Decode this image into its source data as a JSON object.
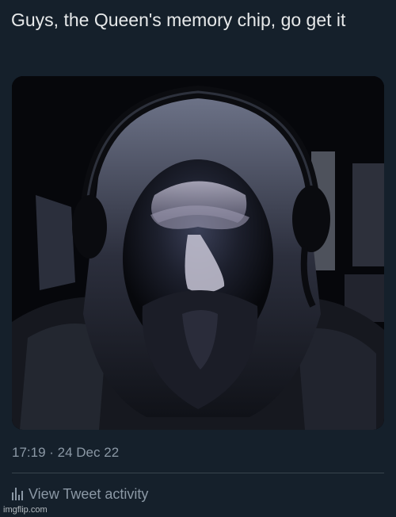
{
  "tweet": {
    "text": "Guys, the Queen's memory chip, go get it",
    "timestamp": "17:19 · 24 Dec 22",
    "activity_label": "View Tweet activity",
    "activity_icon": "bar-chart-icon"
  },
  "watermark": "imgflip.com",
  "colors": {
    "background": "#15202b",
    "text_primary": "#e7e9ea",
    "text_secondary": "#8b98a5",
    "divider": "#38444d"
  }
}
